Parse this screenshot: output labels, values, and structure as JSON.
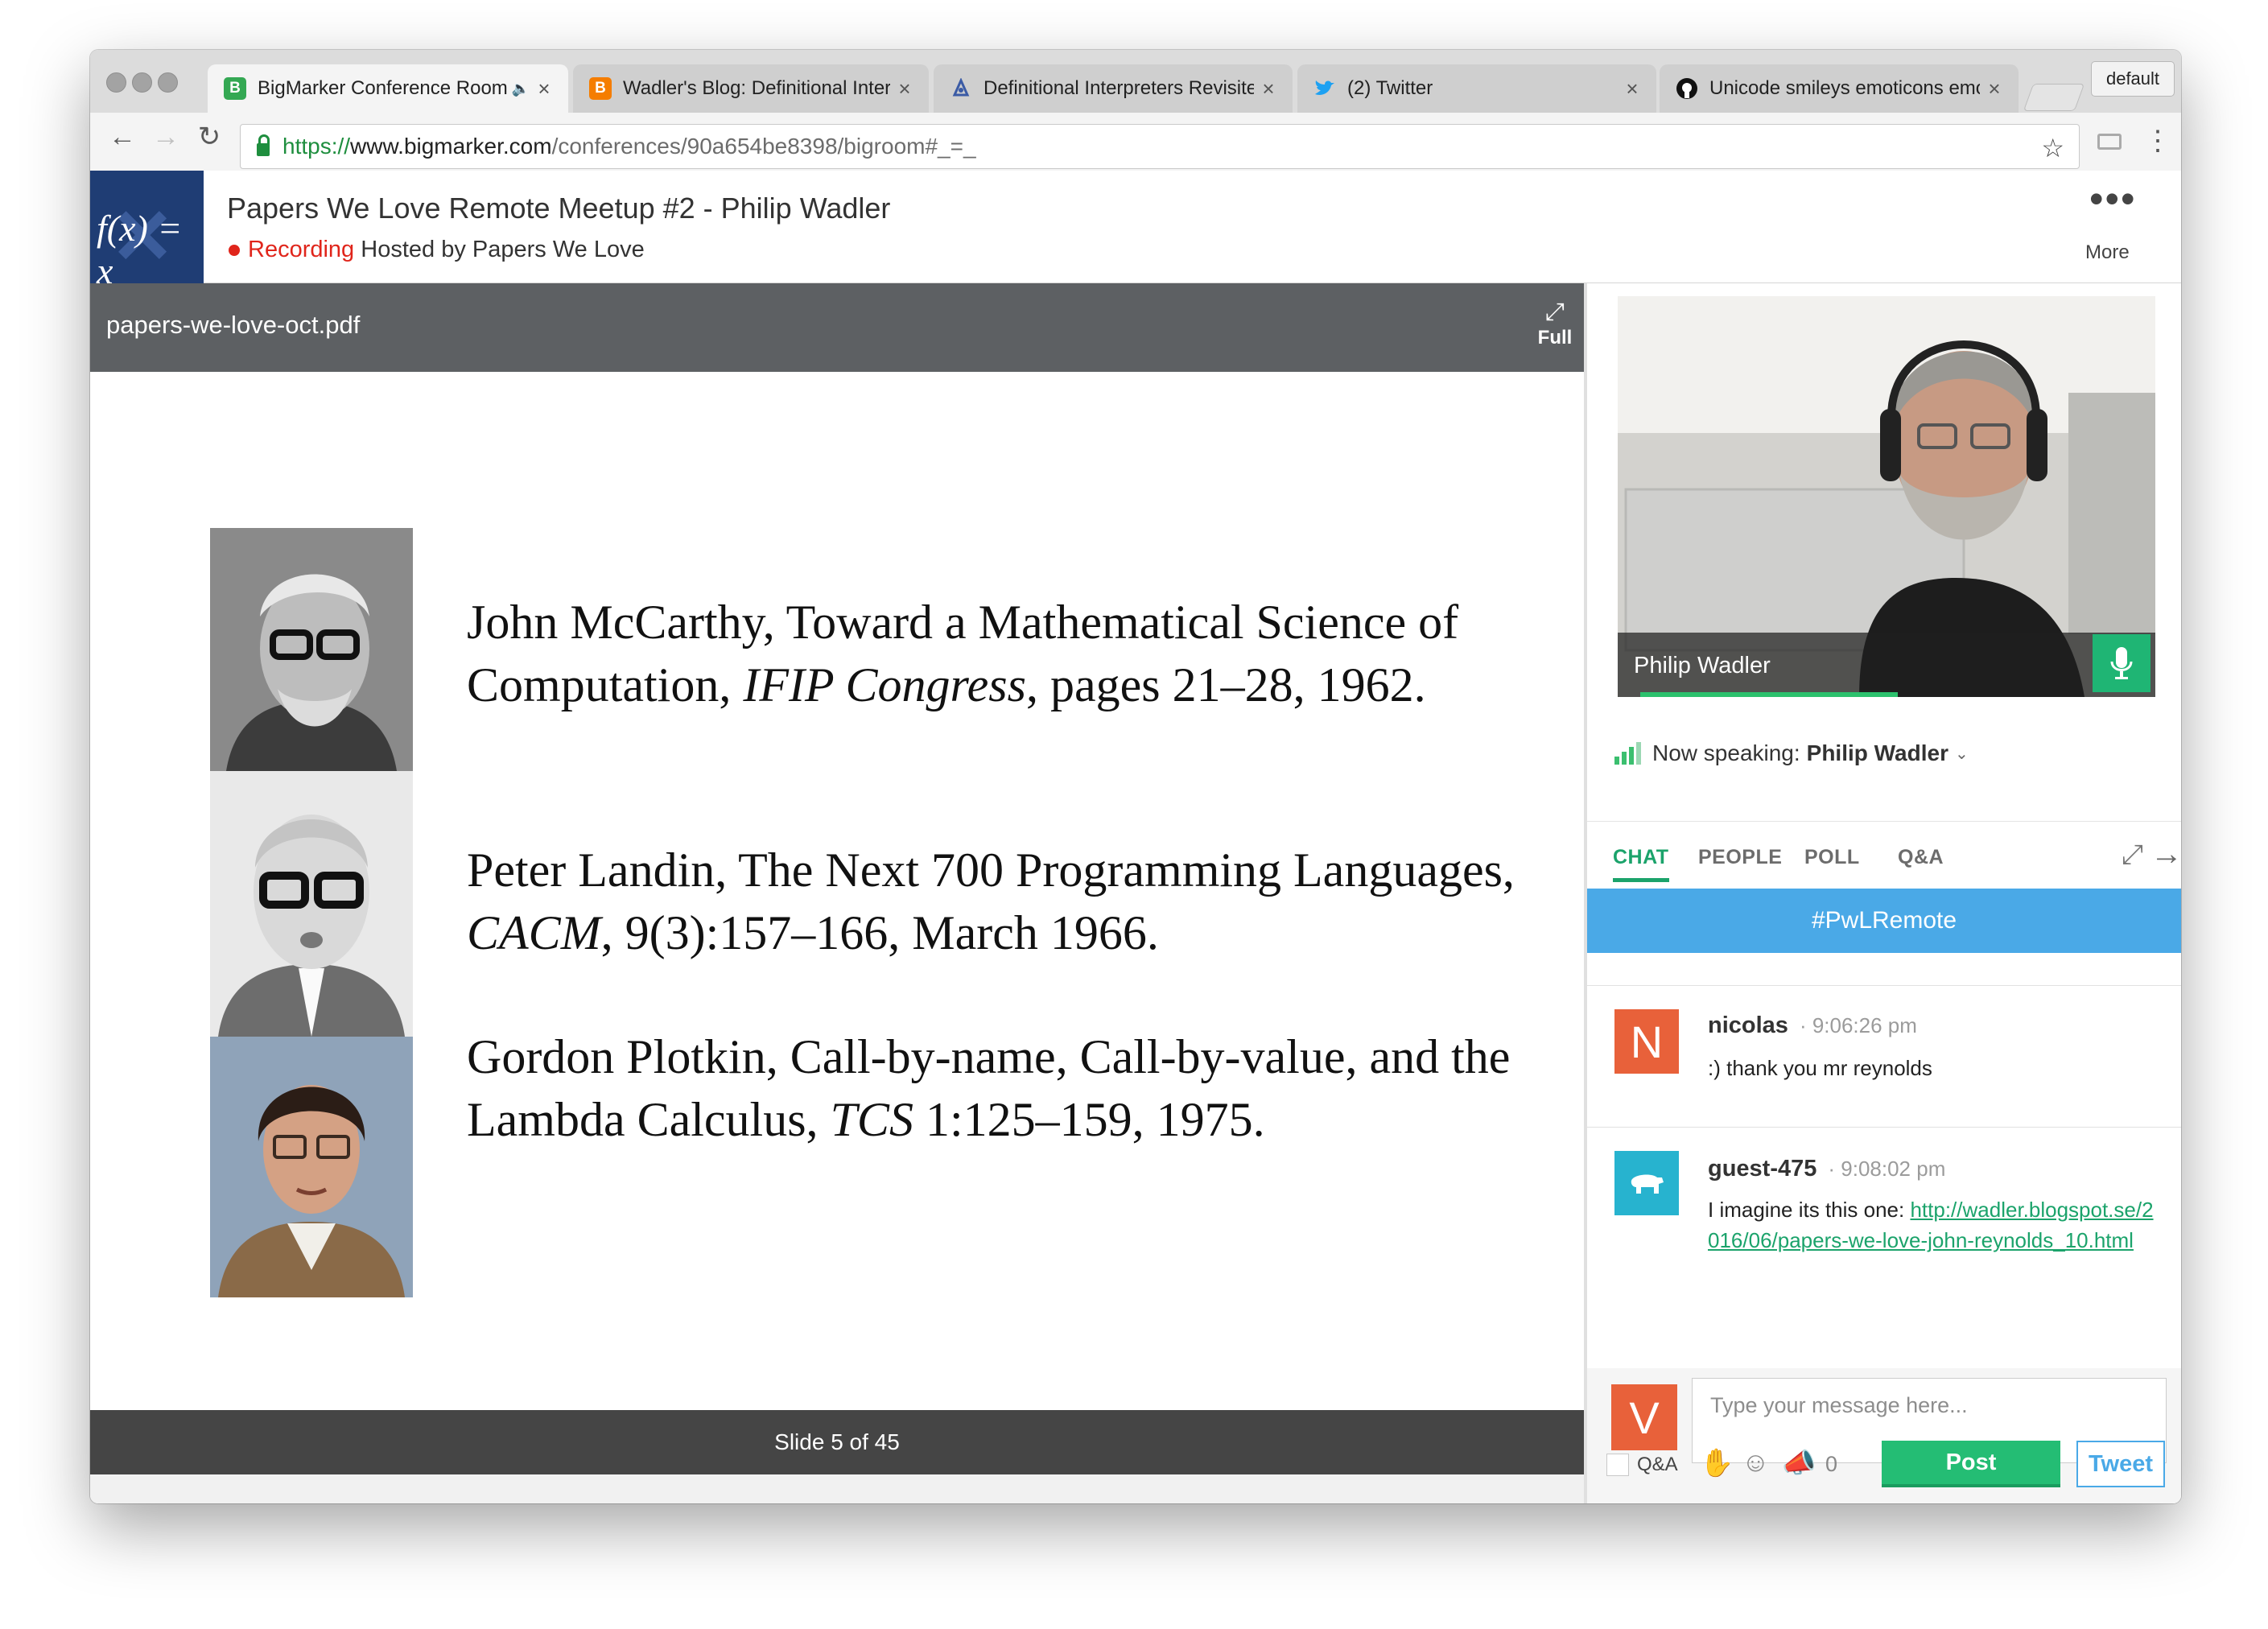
{
  "browser": {
    "tabs": [
      {
        "title": "BigMarker Conference Room",
        "favicon": "B",
        "favicon_color": "#34a853",
        "active": true,
        "audio": true
      },
      {
        "title": "Wadler's Blog: Definitional Interpreters",
        "favicon": "B",
        "favicon_color": "#f57d00",
        "active": false
      },
      {
        "title": "Definitional Interpreters Revisited",
        "favicon": "doc-icon",
        "favicon_color": "#3b5ba5",
        "active": false
      },
      {
        "title": "(2) Twitter",
        "favicon": "twitter-bird-icon",
        "favicon_color": "#1da1f2",
        "active": false
      },
      {
        "title": "Unicode smileys emoticons emoji",
        "favicon": "github-icon",
        "favicon_color": "#111111",
        "active": false
      }
    ],
    "profile_label": "default",
    "url": {
      "scheme": "https://",
      "host": "www.bigmarker.com",
      "path": "/conferences/90a654be8398/bigroom#_=_"
    }
  },
  "header": {
    "logo_text": "f(x) = x",
    "title": "Papers We Love Remote Meetup #2 - Philip Wadler",
    "recording_label": "Recording",
    "hosted_by": "Hosted by Papers We Love",
    "more_label": "More"
  },
  "presentation": {
    "file_name": "papers-we-love-oct.pdf",
    "full_label": "Full",
    "references": [
      {
        "pre": "John McCarthy, Toward a Mathematical Science of Computation, ",
        "venue": "IFIP Congress",
        "post": ", pages 21–28, 1962."
      },
      {
        "pre": "Peter Landin, The Next 700 Programming Languages, ",
        "venue": "CACM",
        "post": ", 9(3):157–166, March 1966."
      },
      {
        "pre": "Gordon Plotkin, Call-by-name, Call-by-value, and the Lambda Calculus, ",
        "venue": "TCS",
        "post": " 1:125–159, 1975."
      }
    ],
    "slide_counter": "Slide 5 of 45"
  },
  "video": {
    "speaker_name": "Philip Wadler"
  },
  "now_speaking": {
    "label": "Now speaking:",
    "name": "Philip Wadler"
  },
  "panel_tabs": [
    "CHAT",
    "PEOPLE",
    "POLL",
    "Q&A"
  ],
  "active_tab": "CHAT",
  "chat": {
    "hashtag": "#PwLRemote",
    "messages": [
      {
        "user": "nicolas",
        "time": "· 9:06:26 pm",
        "text": ":) thank you mr reynolds",
        "avatar_letter": "N",
        "avatar_color": "#e8613a"
      },
      {
        "user": "guest-475",
        "time": "· 9:08:02 pm",
        "text": "I imagine its this one: ",
        "link": "http://wadler.blogspot.se/2016/06/papers-we-love-john-reynolds_10.html",
        "avatar_icon": "polar-bear-icon",
        "avatar_color": "#27b3cf"
      }
    ],
    "composer": {
      "avatar_letter": "V",
      "placeholder": "Type your message here...",
      "qa_label": "Q&A",
      "count": "0",
      "post_label": "Post",
      "tweet_label": "Tweet"
    }
  },
  "colors": {
    "accent_green": "#1ba36b",
    "hashtag_blue": "#4aa9e7",
    "recording_red": "#e0251b",
    "post_green": "#24bd74"
  }
}
